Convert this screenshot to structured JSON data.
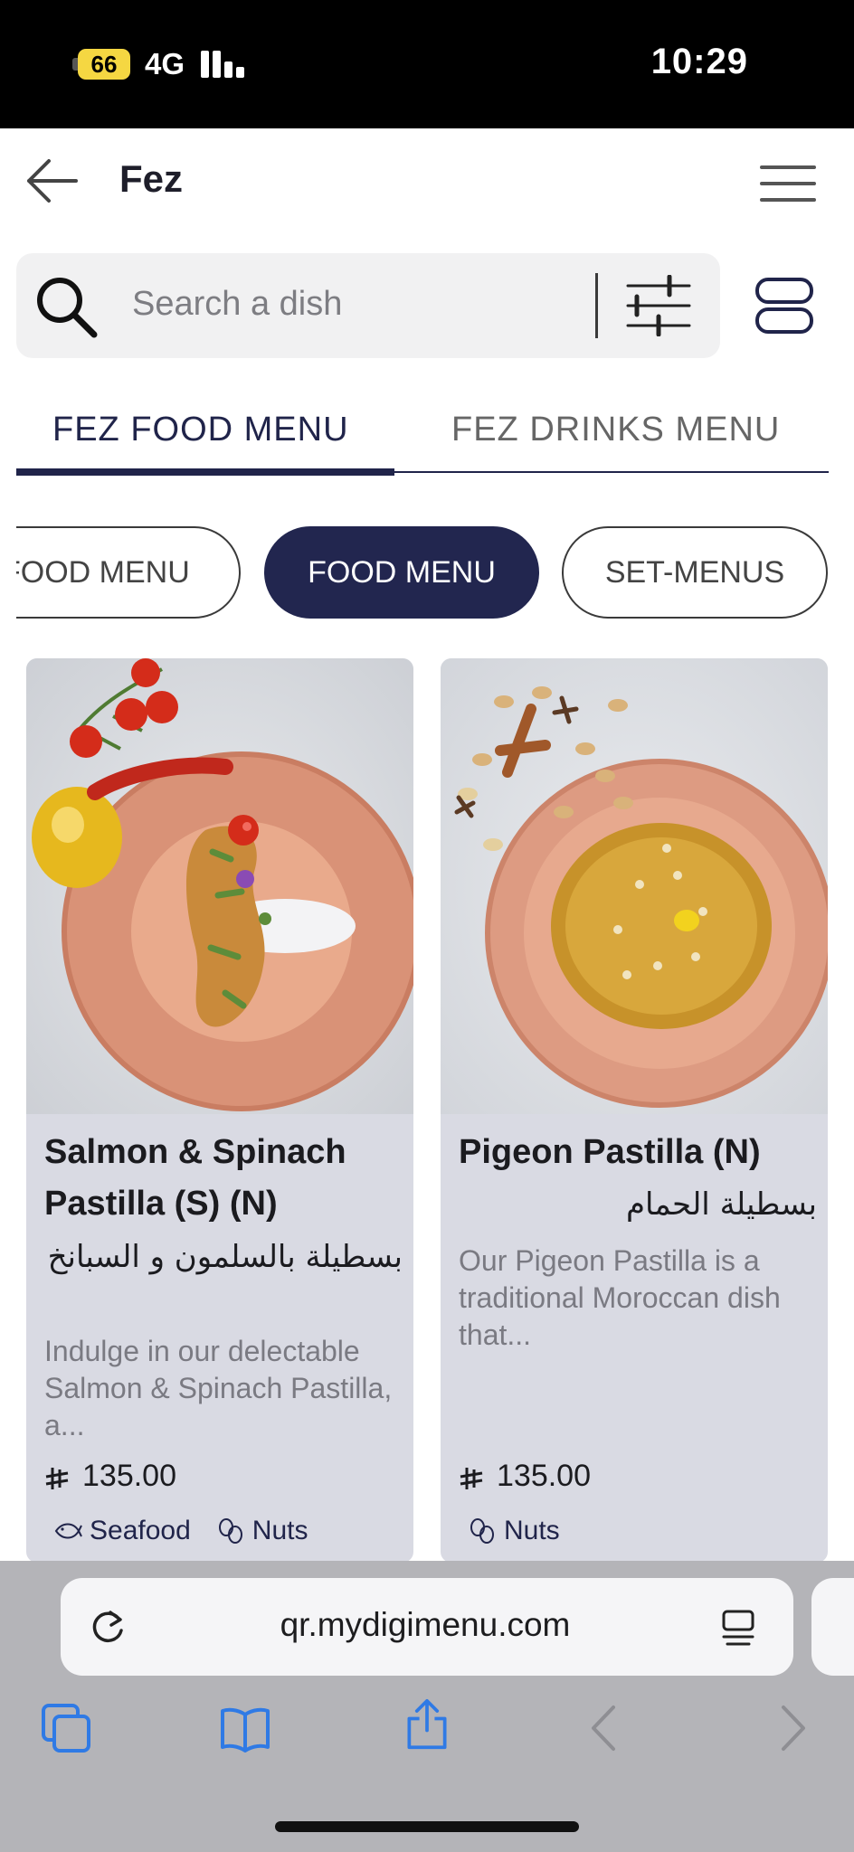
{
  "status_bar": {
    "battery": "66",
    "network": "4G",
    "time": "10:29"
  },
  "header": {
    "title": "Fez"
  },
  "search": {
    "placeholder": "Search a dish"
  },
  "tabs": [
    {
      "label": "FEZ FOOD MENU",
      "active": true
    },
    {
      "label": "FEZ DRINKS MENU",
      "active": false
    }
  ],
  "categories": [
    {
      "label": "FOOD MENU",
      "active": false
    },
    {
      "label": "FOOD MENU",
      "active": true
    },
    {
      "label": "SET-MENUS",
      "active": false
    }
  ],
  "dishes": [
    {
      "name": "Salmon & Spinach Pastilla (S) (N)",
      "arabic_name": "بسطيلة بالسلمون و السبانخ",
      "description": "Indulge in our delectable Salmon & Spinach Pastilla, a...",
      "price": "135.00",
      "tags": [
        "Seafood",
        "Nuts"
      ]
    },
    {
      "name": "Pigeon Pastilla (N)",
      "arabic_name": "بسطيلة الحمام",
      "description": "Our Pigeon Pastilla is a traditional Moroccan dish that...",
      "price": "135.00",
      "tags": [
        "Nuts"
      ]
    }
  ],
  "browser": {
    "url": "qr.mydigimenu.com"
  },
  "colors": {
    "accent": "#22264f",
    "card_background": "#d9dae3",
    "toolbar": "#b4b4b8",
    "browser_icon": "#2f7ae5"
  }
}
